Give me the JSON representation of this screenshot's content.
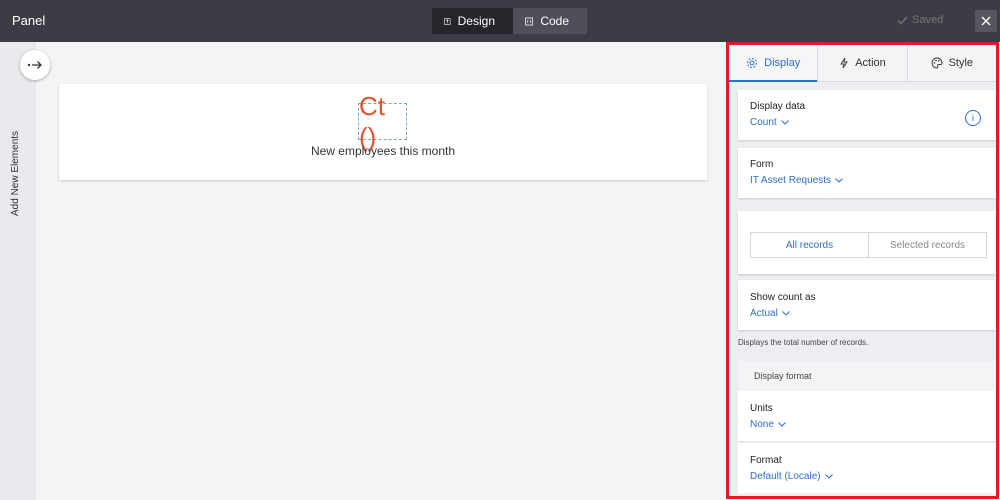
{
  "topbar": {
    "title": "Panel",
    "modes": [
      {
        "label": "Design",
        "icon": "design-icon",
        "active": true
      },
      {
        "label": "Code",
        "icon": "code-icon",
        "active": false
      }
    ],
    "saved_label": "Saved"
  },
  "rail": {
    "label": "Add New Elements"
  },
  "canvas": {
    "metric_value": "Ct ()",
    "metric_caption": "New employees this month",
    "metric_color": "#e5532e"
  },
  "right_panel": {
    "tabs": [
      {
        "label": "Display",
        "icon": "gear-icon",
        "active": true
      },
      {
        "label": "Action",
        "icon": "lightning-icon",
        "active": false
      },
      {
        "label": "Style",
        "icon": "palette-icon",
        "active": false
      }
    ],
    "display_data": {
      "label": "Display data",
      "value": "Count",
      "info_glyph": "i"
    },
    "form": {
      "label": "Form",
      "value": "IT Asset Requests"
    },
    "records": {
      "options": [
        "All records",
        "Selected records"
      ],
      "selected": "All records"
    },
    "show_count": {
      "label": "Show count as",
      "value": "Actual"
    },
    "help_text": "Displays the total number of records.",
    "display_format": {
      "heading": "Display format",
      "units": {
        "label": "Units",
        "value": "None"
      },
      "format": {
        "label": "Format",
        "value": "Default (Locale)"
      }
    }
  },
  "colors": {
    "accent": "#2f6fc9",
    "highlight_border": "#e01b24",
    "topbar": "#3b3c44"
  }
}
